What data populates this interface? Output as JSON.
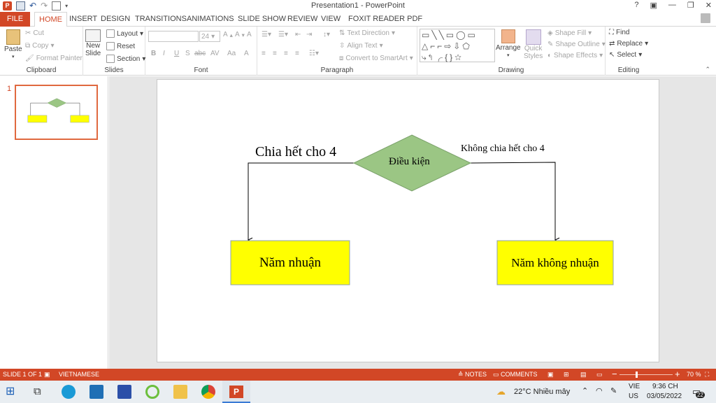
{
  "window": {
    "title": "Presentation1 - PowerPoint",
    "controls": [
      "?",
      "▣",
      "—",
      "❐",
      "✕"
    ]
  },
  "tabs": [
    "FILE",
    "HOME",
    "INSERT",
    "DESIGN",
    "TRANSITIONS",
    "ANIMATIONS",
    "SLIDE SHOW",
    "REVIEW",
    "VIEW",
    "FOXIT READER PDF"
  ],
  "ribbon": {
    "clipboard": {
      "paste": "Paste",
      "cut": "Cut",
      "copy": "Copy",
      "format_painter": "Format Painter",
      "label": "Clipboard"
    },
    "slides": {
      "new_slide_1": "New",
      "new_slide_2": "Slide",
      "layout": "Layout",
      "reset": "Reset",
      "section": "Section",
      "label": "Slides"
    },
    "font": {
      "size": "24",
      "bold": "B",
      "italic": "I",
      "underline": "U",
      "shadow": "S",
      "strike": "abc",
      "spacing": "AV",
      "case": "Aa",
      "color": "A",
      "label": "Font"
    },
    "paragraph": {
      "text_direction": "Text Direction",
      "align_text": "Align Text",
      "smartart": "Convert to SmartArt",
      "label": "Paragraph"
    },
    "drawing": {
      "arrange": "Arrange",
      "quick_styles_1": "Quick",
      "quick_styles_2": "Styles",
      "shape_fill": "Shape Fill",
      "shape_outline": "Shape Outline",
      "shape_effects": "Shape Effects",
      "label": "Drawing"
    },
    "editing": {
      "find": "Find",
      "replace": "Replace",
      "select": "Select",
      "label": "Editing"
    }
  },
  "thumbnail": {
    "number": "1"
  },
  "slide": {
    "left_label": "Chia hết cho 4",
    "right_label": "Không chia hết cho 4",
    "decision": "Điều kiện",
    "box_left": "Năm nhuận",
    "box_right": "Năm không nhuận",
    "colors": {
      "diamond": "#9bc684",
      "diamond_border": "#7aa06a",
      "box": "#ffff00",
      "box_border": "#8ea0b0"
    }
  },
  "statusbar": {
    "slide_info": "SLIDE 1 OF 1",
    "language": "VIETNAMESE",
    "notes": "NOTES",
    "comments": "COMMENTS",
    "zoom": "70 %",
    "minus": "−",
    "plus": "+"
  },
  "taskbar": {
    "weather": "22°C  Nhiều mây",
    "lang_1": "VIE",
    "lang_2": "US",
    "time": "9:36 CH",
    "date": "03/05/2022",
    "notif_count": "22"
  }
}
